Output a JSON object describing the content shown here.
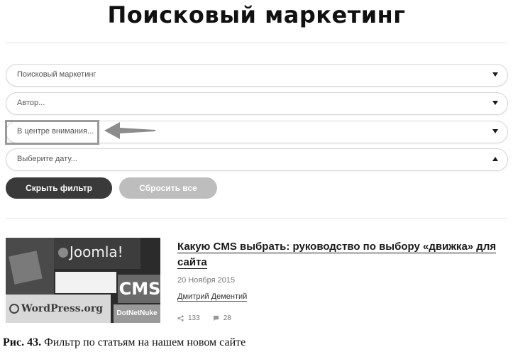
{
  "page": {
    "title": "Поисковый маркетинг"
  },
  "filters": [
    {
      "value": "Поисковый маркетинг",
      "caret": "down"
    },
    {
      "value": "Автор...",
      "caret": "down"
    },
    {
      "value": "В центре внимания...",
      "caret": "down"
    },
    {
      "value": "Выберите дату...",
      "caret": "up"
    }
  ],
  "buttons": {
    "hide_filter": "Скрыть фильтр",
    "reset_all": "Сбросить все"
  },
  "article": {
    "title": "Какую CMS выбрать: руководство по выбору «движка» для сайта",
    "date": "20 Ноября 2015",
    "author": "Дмитрий Дементий",
    "shares": "133",
    "comments": "28",
    "thumbnail_labels": {
      "joomla": "Joomla!",
      "cms": "CMS",
      "wordpress": "WordPress.org",
      "dotnetnuke": "DotNetNuke"
    }
  },
  "caption": {
    "label": "Рис. 43.",
    "text": "Фильтр по статьям на нашем новом сайте"
  },
  "colors": {
    "dark_button": "#3a3a3a",
    "light_button": "#bdbdbd",
    "highlight": "#9a9a9a"
  }
}
